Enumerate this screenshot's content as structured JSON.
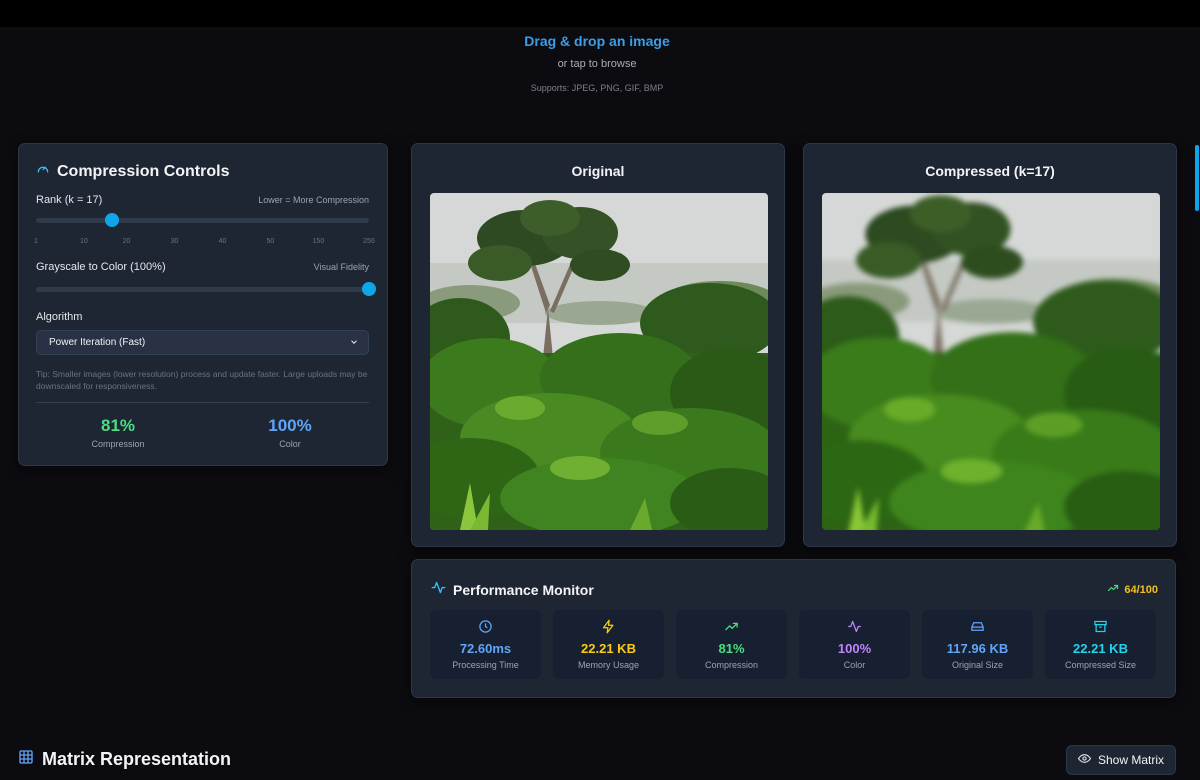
{
  "upload": {
    "title": "Drag & drop an image",
    "subtitle": "or tap to browse",
    "supports": "Supports: JPEG, PNG, GIF, BMP"
  },
  "controls": {
    "title": "Compression Controls",
    "icon": "gauge-icon",
    "rank": {
      "label": "Rank (k = 17)",
      "hint": "Lower = More Compression",
      "value": 17,
      "ticks": [
        "1",
        "10",
        "20",
        "30",
        "40",
        "50",
        "150",
        "256"
      ]
    },
    "color": {
      "label": "Grayscale to Color (100%)",
      "hint": "Visual Fidelity",
      "value_percent": 100
    },
    "algorithm": {
      "label": "Algorithm",
      "selected": "Power Iteration (Fast)"
    },
    "tip": "Tip: Smaller images (lower resolution) process and update faster. Large uploads may be downscaled for responsiveness.",
    "stats": [
      {
        "value": "81%",
        "label": "Compression",
        "color": "#4ade80"
      },
      {
        "value": "100%",
        "label": "Color",
        "color": "#60a5fa"
      }
    ]
  },
  "images": {
    "original_title": "Original",
    "compressed_title": "Compressed (k=17)"
  },
  "performance": {
    "title": "Performance Monitor",
    "score": "64/100",
    "metrics": [
      {
        "value": "72.60ms",
        "label": "Processing Time",
        "icon": "clock-icon",
        "color": "#60a5fa"
      },
      {
        "value": "22.21 KB",
        "label": "Memory Usage",
        "icon": "zap-icon",
        "color": "#facc15"
      },
      {
        "value": "81%",
        "label": "Compression",
        "icon": "trending-up-icon",
        "color": "#4ade80"
      },
      {
        "value": "100%",
        "label": "Color",
        "icon": "activity-icon",
        "color": "#c084fc"
      },
      {
        "value": "117.96 KB",
        "label": "Original Size",
        "icon": "hard-drive-icon",
        "color": "#60a5fa"
      },
      {
        "value": "22.21 KB",
        "label": "Compressed Size",
        "icon": "archive-icon",
        "color": "#22d3ee"
      }
    ]
  },
  "matrix": {
    "title": "Matrix Representation",
    "button_label": "Show Matrix"
  }
}
